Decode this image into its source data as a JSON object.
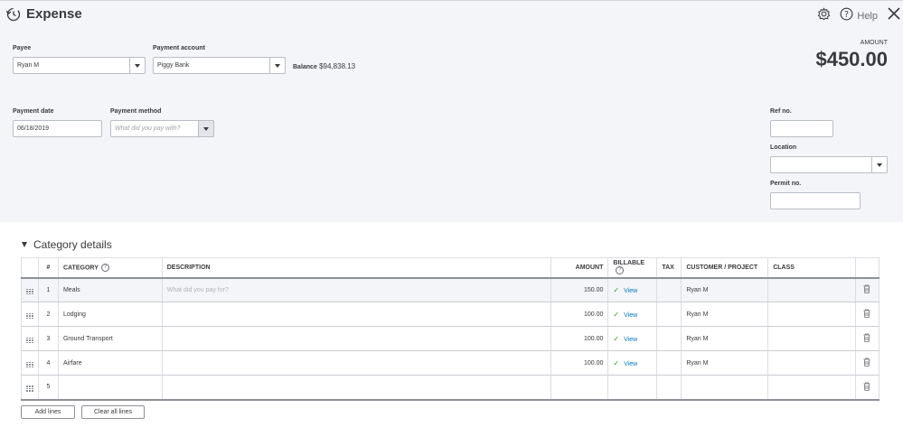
{
  "header": {
    "title": "Expense",
    "help_label": "Help"
  },
  "form": {
    "payee": {
      "label": "Payee",
      "value": "Ryan M"
    },
    "payment_account": {
      "label": "Payment account",
      "value": "Piggy Bank"
    },
    "balance": {
      "label": "Balance",
      "value": "$94,838.13"
    },
    "payment_date": {
      "label": "Payment date",
      "value": "06/18/2019"
    },
    "payment_method": {
      "label": "Payment method",
      "placeholder": "What did you pay with?"
    },
    "ref_no": {
      "label": "Ref no.",
      "value": ""
    },
    "location": {
      "label": "Location",
      "value": ""
    },
    "permit_no": {
      "label": "Permit no.",
      "value": ""
    },
    "amount": {
      "label": "AMOUNT",
      "value": "$450.00"
    }
  },
  "category_details": {
    "title": "Category details",
    "columns": {
      "num": "#",
      "category": "CATEGORY",
      "description": "DESCRIPTION",
      "amount": "AMOUNT",
      "billable": "BILLABLE",
      "tax": "TAX",
      "customer": "CUSTOMER / PROJECT",
      "class": "CLASS"
    },
    "description_placeholder": "What did you pay for?",
    "view_label": "View",
    "rows": [
      {
        "num": "1",
        "category": "Meals",
        "amount": "150.00",
        "customer": "Ryan M"
      },
      {
        "num": "2",
        "category": "Lodging",
        "amount": "100.00",
        "customer": "Ryan M"
      },
      {
        "num": "3",
        "category": "Ground Transport",
        "amount": "100.00",
        "customer": "Ryan M"
      },
      {
        "num": "4",
        "category": "Airfare",
        "amount": "100.00",
        "customer": "Ryan M"
      },
      {
        "num": "5"
      }
    ],
    "add_lines_label": "Add lines",
    "clear_lines_label": "Clear all lines"
  },
  "icons": [
    "history-icon",
    "gear-icon",
    "help-icon",
    "close-icon",
    "question-icon",
    "drag-handle-icon",
    "trash-icon",
    "check-icon",
    "chevron-down-icon"
  ],
  "colors": {
    "accent_green": "#2ca01c",
    "link_blue": "#0077c5",
    "panel_bg": "#f4f5f8"
  }
}
